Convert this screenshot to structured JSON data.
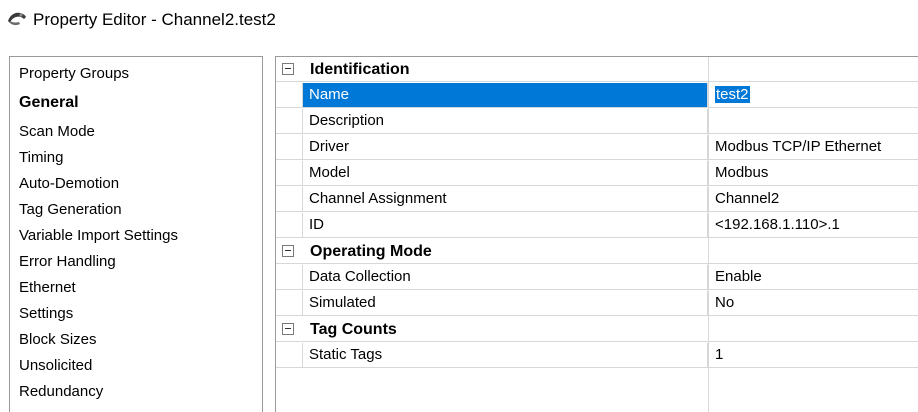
{
  "window": {
    "title": "Property Editor - Channel2.test2",
    "icon": "channel-icon"
  },
  "groups": {
    "header": "Property Groups",
    "items": [
      {
        "label": "General",
        "selected": true
      },
      {
        "label": "Scan Mode"
      },
      {
        "label": "Timing"
      },
      {
        "label": "Auto-Demotion"
      },
      {
        "label": "Tag Generation"
      },
      {
        "label": "Variable Import Settings"
      },
      {
        "label": "Error Handling"
      },
      {
        "label": "Ethernet"
      },
      {
        "label": "Settings"
      },
      {
        "label": "Block Sizes"
      },
      {
        "label": "Unsolicited"
      },
      {
        "label": "Redundancy"
      }
    ]
  },
  "grid": {
    "categories": [
      {
        "label": "Identification",
        "rows": [
          {
            "name": "Name",
            "value": "test2",
            "selected": true
          },
          {
            "name": "Description",
            "value": ""
          },
          {
            "name": "Driver",
            "value": "Modbus TCP/IP Ethernet"
          },
          {
            "name": "Model",
            "value": "Modbus"
          },
          {
            "name": "Channel Assignment",
            "value": "Channel2"
          },
          {
            "name": "ID",
            "value": "<192.168.1.110>.1"
          }
        ]
      },
      {
        "label": "Operating Mode",
        "rows": [
          {
            "name": "Data Collection",
            "value": "Enable"
          },
          {
            "name": "Simulated",
            "value": "No"
          }
        ]
      },
      {
        "label": "Tag Counts",
        "rows": [
          {
            "name": "Static Tags",
            "value": "1"
          }
        ]
      }
    ]
  },
  "colors": {
    "selection": "#0078d7",
    "gridline": "#d7d7d7",
    "border": "#9a9a9a"
  }
}
